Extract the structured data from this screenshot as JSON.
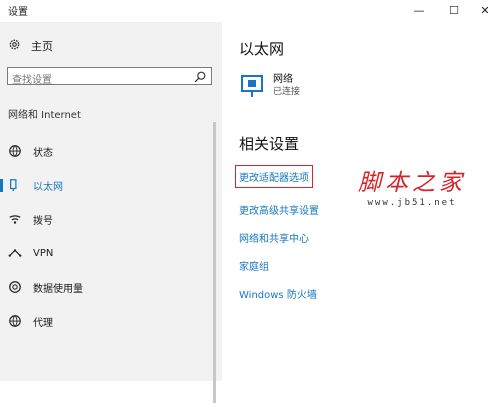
{
  "window": {
    "title": "设置"
  },
  "sidebar": {
    "home_label": "主页",
    "search_placeholder": "查找设置",
    "section_label": "网络和 Internet",
    "items": [
      {
        "label": "状态",
        "icon": "globe-status-icon"
      },
      {
        "label": "以太网",
        "icon": "ethernet-icon",
        "active": true
      },
      {
        "label": "拨号",
        "icon": "dialup-icon"
      },
      {
        "label": "VPN",
        "icon": "vpn-icon"
      },
      {
        "label": "数据使用量",
        "icon": "data-usage-icon"
      },
      {
        "label": "代理",
        "icon": "globe-proxy-icon"
      }
    ]
  },
  "main": {
    "title": "以太网",
    "network": {
      "name": "网络",
      "status": "已连接"
    },
    "related_title": "相关设置",
    "links": [
      {
        "label": "更改适配器选项",
        "highlighted": true
      },
      {
        "label": "更改高级共享设置"
      },
      {
        "label": "网络和共享中心"
      },
      {
        "label": "家庭组"
      },
      {
        "label": "Windows 防火墙"
      }
    ]
  },
  "watermark": {
    "text": "脚本之家",
    "url": "www.jb51.net"
  },
  "colors": {
    "accent": "#1677c0",
    "highlight_box": "#d8252c",
    "watermark": "#d72227",
    "sidebar_bg": "#f2f2f2"
  }
}
